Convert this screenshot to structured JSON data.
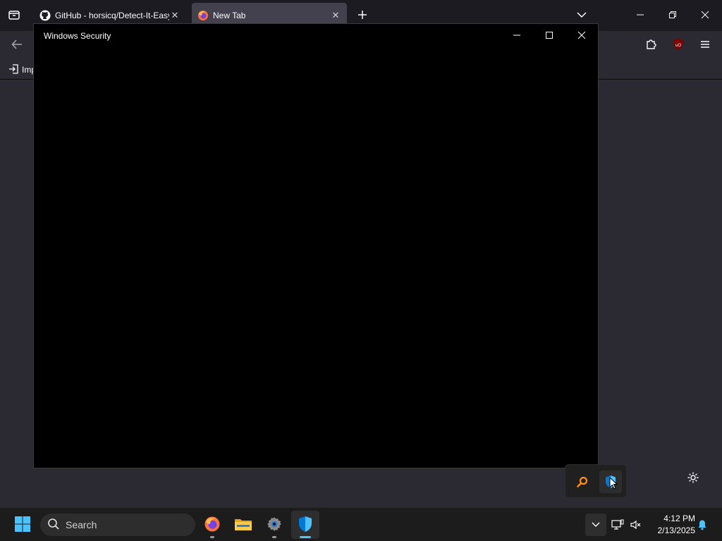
{
  "browser": {
    "tabs": [
      {
        "title": "GitHub - horsicq/Detect-It-Easy",
        "favicon": "github-icon"
      },
      {
        "title": "New Tab",
        "favicon": "firefox-icon"
      }
    ],
    "bookmarks": [
      {
        "label": "Imp",
        "icon": "import-icon"
      }
    ]
  },
  "security_window": {
    "title": "Windows Security"
  },
  "taskbar": {
    "search_label": "Search",
    "apps": [
      "firefox-icon",
      "file-explorer-icon",
      "settings-icon",
      "windows-security-icon"
    ],
    "clock": {
      "time": "4:12 PM",
      "date": "2/13/2025"
    }
  },
  "colors": {
    "accent": "#4cc2ff",
    "security_blue": "#0078d4",
    "firefox_orange": "#ff7139",
    "ublock_red": "#800000"
  }
}
